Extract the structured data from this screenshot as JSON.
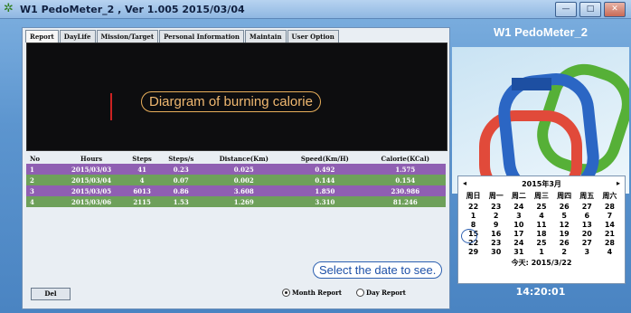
{
  "window": {
    "title": "W1 PedoMeter_2 , Ver 1.005  2015/03/04",
    "controls": [
      "—",
      "□",
      "✕"
    ]
  },
  "tabs": [
    "Report",
    "DayLife",
    "Mission/Target",
    "Personal Information",
    "Maintain",
    "User Option"
  ],
  "chart": {
    "callout": "Diargram of burning calorie"
  },
  "table": {
    "headers": [
      "No",
      "Hours",
      "Steps",
      "Steps/s",
      "Distance(Km)",
      "Speed(Km/H)",
      "Calorie(KCal)"
    ],
    "rows": [
      [
        "1",
        "2015/03/03",
        "41",
        "0.23",
        "0.025",
        "0.492",
        "1.575"
      ],
      [
        "2",
        "2015/03/04",
        "4",
        "0.07",
        "0.002",
        "0.144",
        "0.154"
      ],
      [
        "3",
        "2015/03/05",
        "6013",
        "0.86",
        "3.608",
        "1.850",
        "230.986"
      ],
      [
        "4",
        "2015/03/06",
        "2115",
        "1.53",
        "1.269",
        "3.310",
        "81.246"
      ]
    ]
  },
  "bottom": {
    "delete_label": "Del",
    "month_report": "Month Report",
    "day_report": "Day Report"
  },
  "select_callout": "Select the date to see.",
  "brand_title": "W1 PedoMeter_2",
  "calendar": {
    "prev": "◂",
    "next": "▸",
    "month": "2015年3月",
    "weekdays": [
      "周日",
      "周一",
      "周二",
      "周三",
      "周四",
      "周五",
      "周六"
    ],
    "days": [
      "22",
      "23",
      "24",
      "25",
      "26",
      "27",
      "28",
      "1",
      "2",
      "3",
      "4",
      "5",
      "6",
      "7",
      "8",
      "9",
      "10",
      "11",
      "12",
      "13",
      "14",
      "15",
      "16",
      "17",
      "18",
      "19",
      "20",
      "21",
      "22",
      "23",
      "24",
      "25",
      "26",
      "27",
      "28",
      "29",
      "30",
      "31",
      "1",
      "2",
      "3",
      "4"
    ],
    "today_label": "今天: 2015/3/22"
  },
  "clock": "14:20:01"
}
